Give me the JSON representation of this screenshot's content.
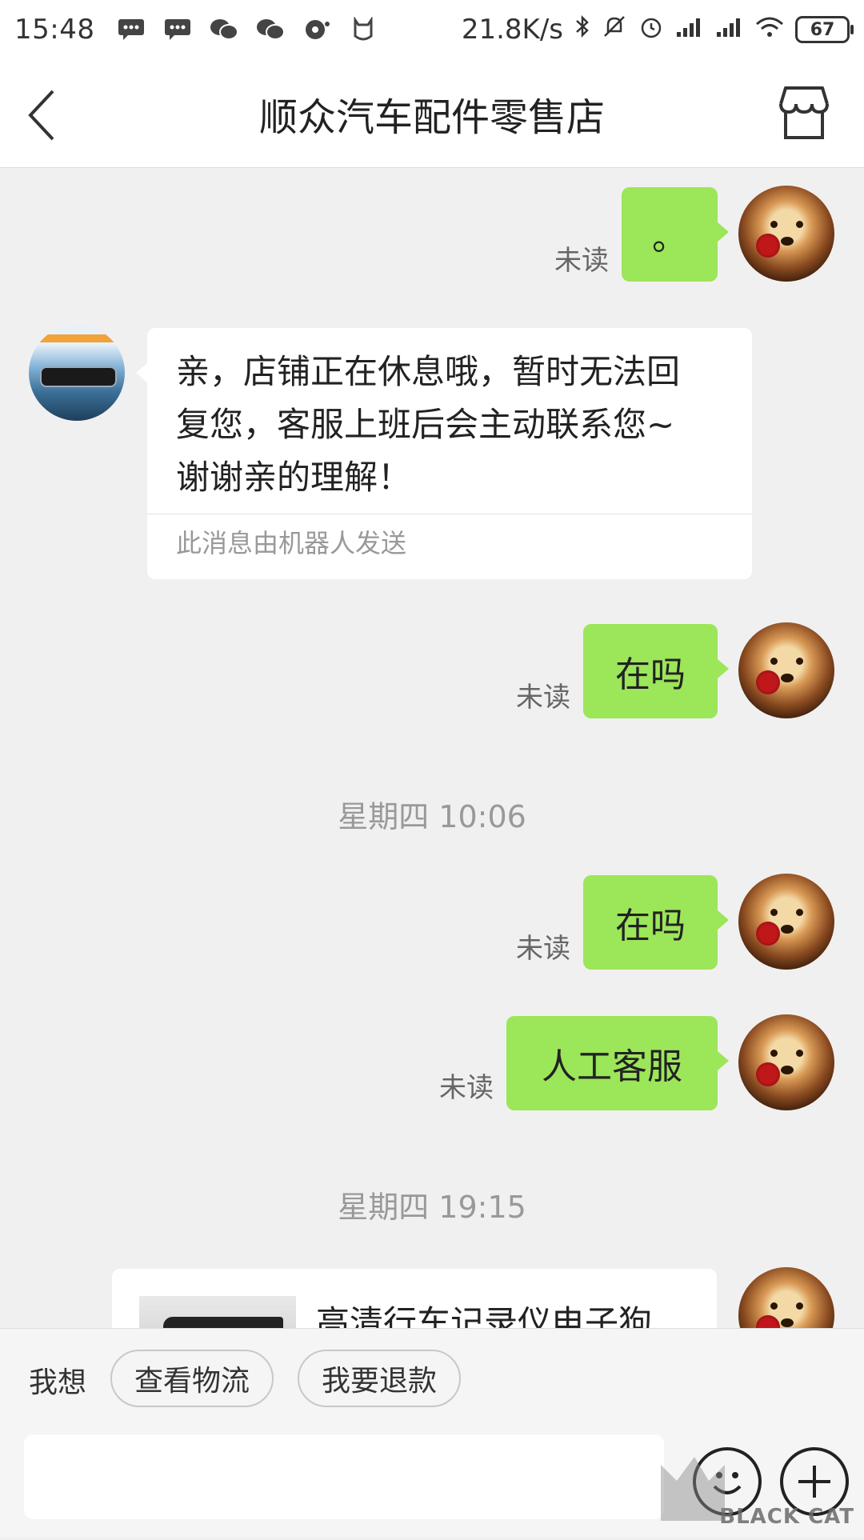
{
  "status_bar": {
    "time": "15:48",
    "network_speed": "21.8K/s",
    "battery_level": "67"
  },
  "nav": {
    "title": "顺众汽车配件零售店"
  },
  "messages": {
    "m1": {
      "text": "。",
      "status": "未读"
    },
    "m2": {
      "lines": [
        "亲，店铺正在休息哦，暂时无法回",
        "复您，客服上班后会主动联系您~",
        "谢谢亲的理解！"
      ],
      "footer": "此消息由机器人发送"
    },
    "m3": {
      "text": "在吗",
      "status": "未读"
    },
    "ts1": "星期四 10:06",
    "m4": {
      "text": "在吗",
      "status": "未读"
    },
    "m5": {
      "text": "人工客服",
      "status": "未读"
    },
    "ts2": "星期四 19:15",
    "m6": {
      "product_title": "高清行车记录仪电子狗"
    }
  },
  "bottom": {
    "quick_label": "我想",
    "chips": [
      "查看物流",
      "我要退款"
    ]
  },
  "watermark": {
    "text": "BLACK CAT"
  },
  "colors": {
    "bubble_green": "#9ce659",
    "background": "#f0f0f0",
    "timestamp": "#999999"
  }
}
